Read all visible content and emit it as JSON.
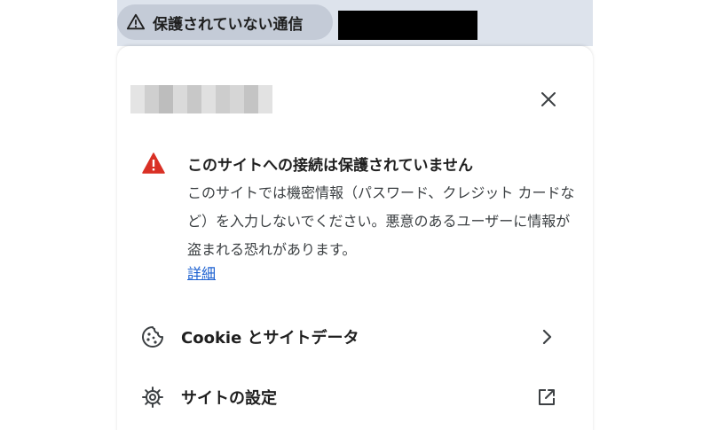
{
  "toolbar": {
    "security_chip_label": "保護されていない通信",
    "security_chip_icon": "warning-outline-icon"
  },
  "panel": {
    "close_icon": "close-icon",
    "warning": {
      "icon": "warning-filled-icon",
      "icon_color": "#d93025",
      "title": "このサイトへの接続は保護されていません",
      "body": "このサイトでは機密情報（パスワード、クレジット カードなど）を入力しないでください。悪意のあるユーザーに情報が盗まれる恐れがあります。",
      "link": "詳細",
      "link_color": "#1a5fd0"
    },
    "rows": [
      {
        "icon": "cookie-icon",
        "label": "Cookie とサイトデータ",
        "trail_icon": "chevron-right-icon"
      },
      {
        "icon": "gear-icon",
        "label": "サイトの設定",
        "trail_icon": "open-in-new-icon"
      }
    ]
  }
}
